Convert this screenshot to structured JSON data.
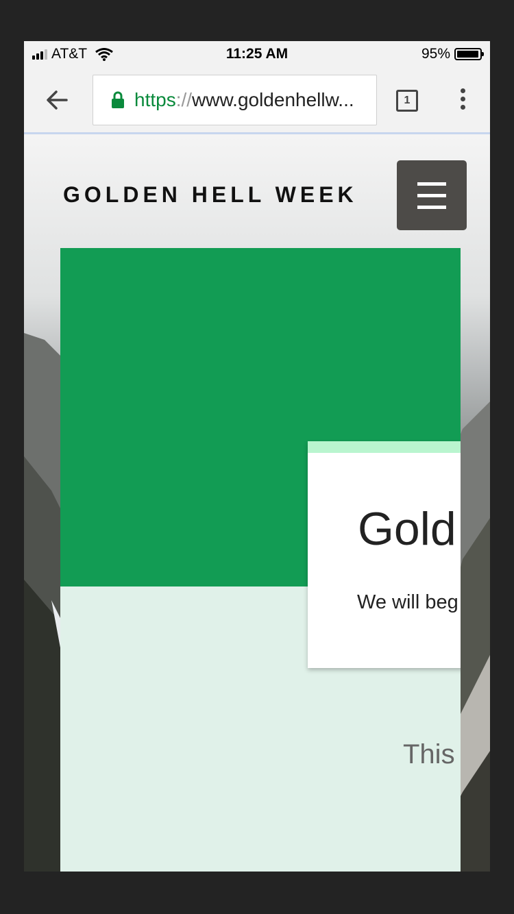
{
  "status_bar": {
    "carrier": "AT&T",
    "time": "11:25 AM",
    "battery": "95%"
  },
  "browser": {
    "url_scheme": "https",
    "url_separator": "://",
    "url_rest": "www.goldenhellw...",
    "tab_count": "1",
    "icons": [
      "back-arrow-icon",
      "lock-icon",
      "tabs-icon",
      "overflow-menu-icon"
    ],
    "lock_color": "#0a8a3c"
  },
  "site": {
    "title": "GOLDEN HELL WEEK",
    "menu_icon": "hamburger-icon"
  },
  "hero": {
    "card_title": "Gold",
    "card_subtitle": "We will beg",
    "lower_text": "This",
    "colors": {
      "hero_green": "#129c54",
      "card_accent": "#b9f5cf",
      "content_bg": "#e0f1e9"
    }
  }
}
